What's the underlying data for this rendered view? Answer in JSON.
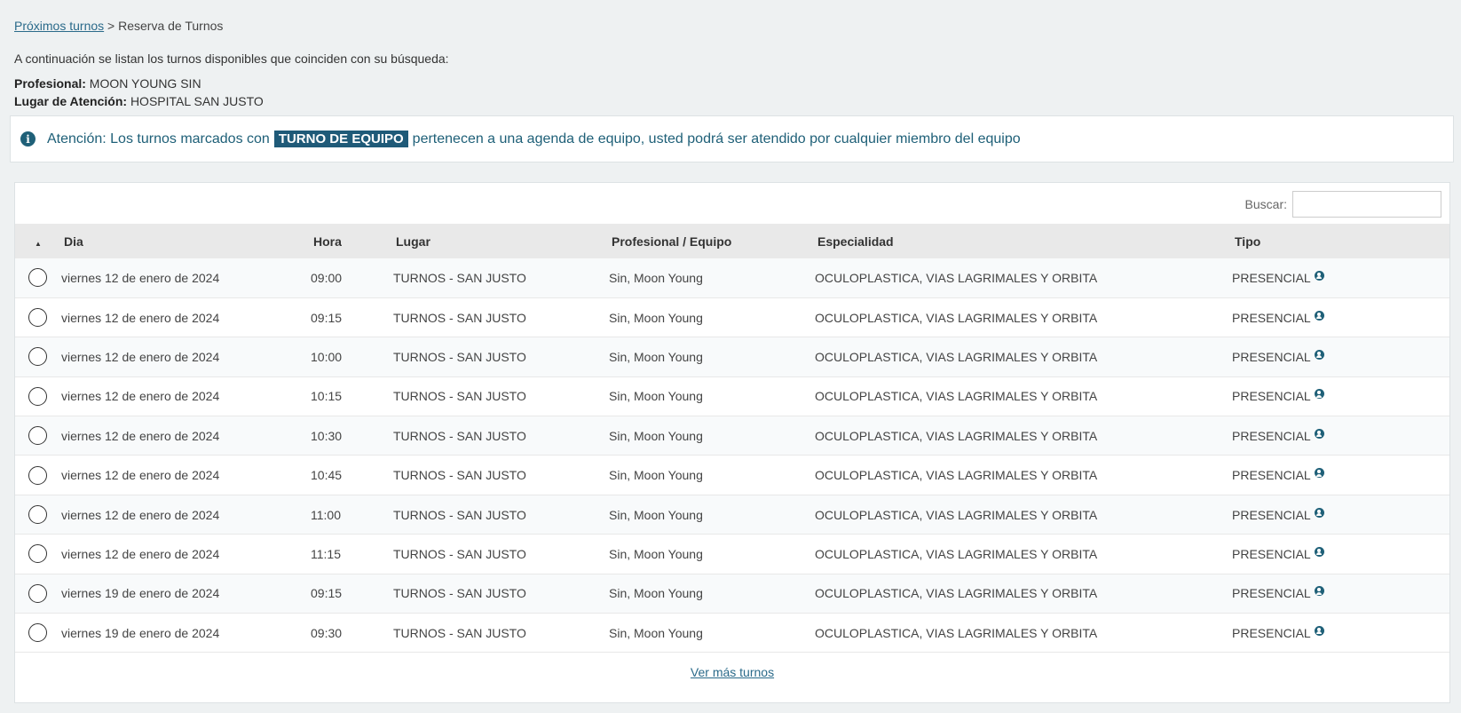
{
  "breadcrumb": {
    "link": "Próximos turnos",
    "separator": " > ",
    "current": "Reserva de Turnos"
  },
  "intro": "A continuación se listan los turnos disponibles que coinciden con su búsqueda:",
  "profesional": {
    "label": "Profesional:",
    "value": "MOON YOUNG SIN"
  },
  "lugar": {
    "label": "Lugar de Atención:",
    "value": "HOSPITAL SAN JUSTO"
  },
  "alert": {
    "before": "Atención: Los turnos marcados con",
    "badge": "TURNO DE EQUIPO",
    "after": "pertenecen a una agenda de equipo, usted podrá ser atendido por cualquier miembro del equipo"
  },
  "search": {
    "label": "Buscar:",
    "value": ""
  },
  "table": {
    "headers": [
      "Dia",
      "Hora",
      "Lugar",
      "Profesional / Equipo",
      "Especialidad",
      "Tipo"
    ],
    "rows": [
      {
        "dia": "viernes 12 de enero de 2024",
        "hora": "09:00",
        "lugar": "TURNOS - SAN JUSTO",
        "profesional": "Sin, Moon Young",
        "especialidad": "OCULOPLASTICA, VIAS LAGRIMALES Y ORBITA",
        "tipo": "PRESENCIAL"
      },
      {
        "dia": "viernes 12 de enero de 2024",
        "hora": "09:15",
        "lugar": "TURNOS - SAN JUSTO",
        "profesional": "Sin, Moon Young",
        "especialidad": "OCULOPLASTICA, VIAS LAGRIMALES Y ORBITA",
        "tipo": "PRESENCIAL"
      },
      {
        "dia": "viernes 12 de enero de 2024",
        "hora": "10:00",
        "lugar": "TURNOS - SAN JUSTO",
        "profesional": "Sin, Moon Young",
        "especialidad": "OCULOPLASTICA, VIAS LAGRIMALES Y ORBITA",
        "tipo": "PRESENCIAL"
      },
      {
        "dia": "viernes 12 de enero de 2024",
        "hora": "10:15",
        "lugar": "TURNOS - SAN JUSTO",
        "profesional": "Sin, Moon Young",
        "especialidad": "OCULOPLASTICA, VIAS LAGRIMALES Y ORBITA",
        "tipo": "PRESENCIAL"
      },
      {
        "dia": "viernes 12 de enero de 2024",
        "hora": "10:30",
        "lugar": "TURNOS - SAN JUSTO",
        "profesional": "Sin, Moon Young",
        "especialidad": "OCULOPLASTICA, VIAS LAGRIMALES Y ORBITA",
        "tipo": "PRESENCIAL"
      },
      {
        "dia": "viernes 12 de enero de 2024",
        "hora": "10:45",
        "lugar": "TURNOS - SAN JUSTO",
        "profesional": "Sin, Moon Young",
        "especialidad": "OCULOPLASTICA, VIAS LAGRIMALES Y ORBITA",
        "tipo": "PRESENCIAL"
      },
      {
        "dia": "viernes 12 de enero de 2024",
        "hora": "11:00",
        "lugar": "TURNOS - SAN JUSTO",
        "profesional": "Sin, Moon Young",
        "especialidad": "OCULOPLASTICA, VIAS LAGRIMALES Y ORBITA",
        "tipo": "PRESENCIAL"
      },
      {
        "dia": "viernes 12 de enero de 2024",
        "hora": "11:15",
        "lugar": "TURNOS - SAN JUSTO",
        "profesional": "Sin, Moon Young",
        "especialidad": "OCULOPLASTICA, VIAS LAGRIMALES Y ORBITA",
        "tipo": "PRESENCIAL"
      },
      {
        "dia": "viernes 19 de enero de 2024",
        "hora": "09:15",
        "lugar": "TURNOS - SAN JUSTO",
        "profesional": "Sin, Moon Young",
        "especialidad": "OCULOPLASTICA, VIAS LAGRIMALES Y ORBITA",
        "tipo": "PRESENCIAL"
      },
      {
        "dia": "viernes 19 de enero de 2024",
        "hora": "09:30",
        "lugar": "TURNOS - SAN JUSTO",
        "profesional": "Sin, Moon Young",
        "especialidad": "OCULOPLASTICA, VIAS LAGRIMALES Y ORBITA",
        "tipo": "PRESENCIAL"
      }
    ]
  },
  "more_link": "Ver más turnos",
  "icons": {
    "alert": "info-circle-icon",
    "tipo": "user-circle-icon",
    "sort": "sort-ascending-icon"
  },
  "colors": {
    "accent": "#1f6078",
    "link": "#2a6a8a",
    "badge_bg": "#1f5a78",
    "page_bg": "#eef1f2"
  }
}
